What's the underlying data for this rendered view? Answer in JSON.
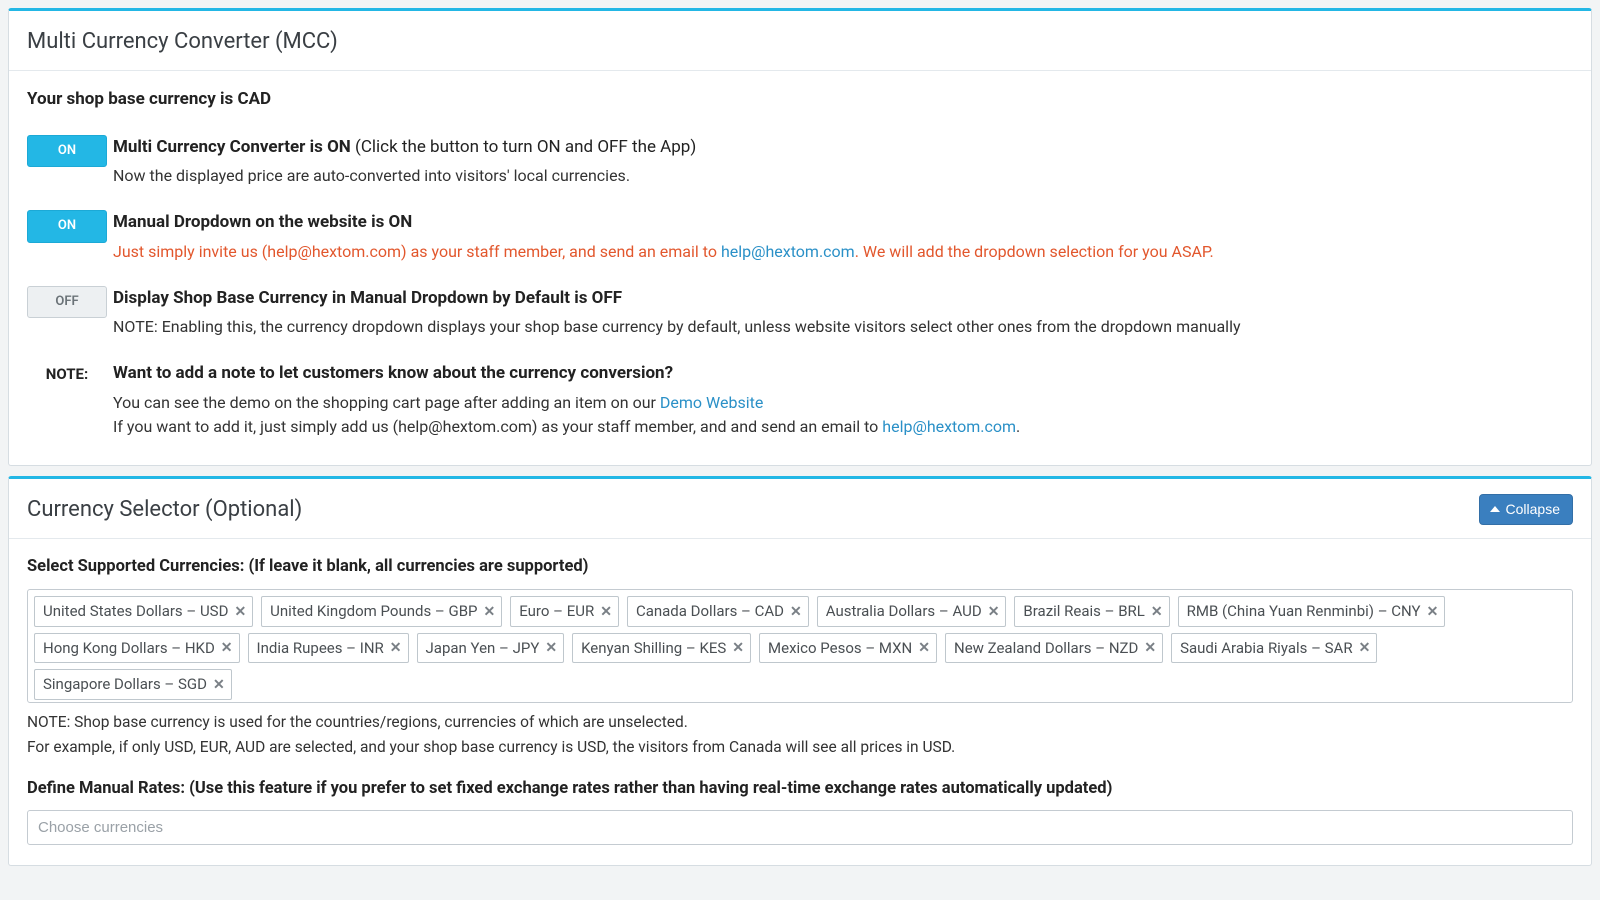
{
  "panel1": {
    "title": "Multi Currency Converter (MCC)",
    "base_line": "Your shop base currency is CAD",
    "r1": {
      "toggle": "ON",
      "title_bold": "Multi Currency Converter is ON",
      "title_light": " (Click the button to turn ON and OFF the App)",
      "desc": "Now the displayed price are auto-converted into visitors' local currencies."
    },
    "r2": {
      "toggle": "ON",
      "title_bold": "Manual Dropdown on the website is ON",
      "warn_pre": "Just simply invite us (help@hextom.com) as your staff member, and send an email to ",
      "link": "help@hextom.com",
      "warn_post": ". We will add the dropdown selection for you ASAP."
    },
    "r3": {
      "toggle": "OFF",
      "title_bold": "Display Shop Base Currency in Manual Dropdown by Default is OFF",
      "desc": "NOTE: Enabling this, the currency dropdown displays your shop base currency by default, unless website visitors select other ones from the dropdown manually"
    },
    "r4": {
      "label": "NOTE:",
      "title_bold": "Want to add a note to let customers know about the currency conversion?",
      "d1_pre": "You can see the demo on the shopping cart page after adding an item on our ",
      "d1_link": "Demo Website",
      "d2_pre": "If you want to add it, just simply add us (help@hextom.com) as your staff member, and and send an email to ",
      "d2_link": "help@hextom.com",
      "d2_post": "."
    }
  },
  "panel2": {
    "title": "Currency Selector (Optional)",
    "collapse": "Collapse",
    "select_label": "Select Supported Currencies: (If leave it blank, all currencies are supported)",
    "tags": [
      "United States Dollars – USD",
      "United Kingdom Pounds – GBP",
      "Euro – EUR",
      "Canada Dollars – CAD",
      "Australia Dollars – AUD",
      "Brazil Reais – BRL",
      "RMB (China Yuan Renminbi) – CNY",
      "Hong Kong Dollars – HKD",
      "India Rupees – INR",
      "Japan Yen – JPY",
      "Kenyan Shilling – KES",
      "Mexico Pesos – MXN",
      "New Zealand Dollars – NZD",
      "Saudi Arabia Riyals – SAR",
      "Singapore Dollars – SGD"
    ],
    "note1": "NOTE: Shop base currency is used for the countries/regions, currencies of which are unselected.",
    "note2": "For example, if only USD, EUR, AUD are selected, and your shop base currency is USD, the visitors from Canada will see all prices in USD.",
    "manual_label": "Define Manual Rates: (Use this feature if you prefer to set fixed exchange rates rather than having real-time exchange rates automatically updated)",
    "choose_placeholder": "Choose currencies"
  }
}
